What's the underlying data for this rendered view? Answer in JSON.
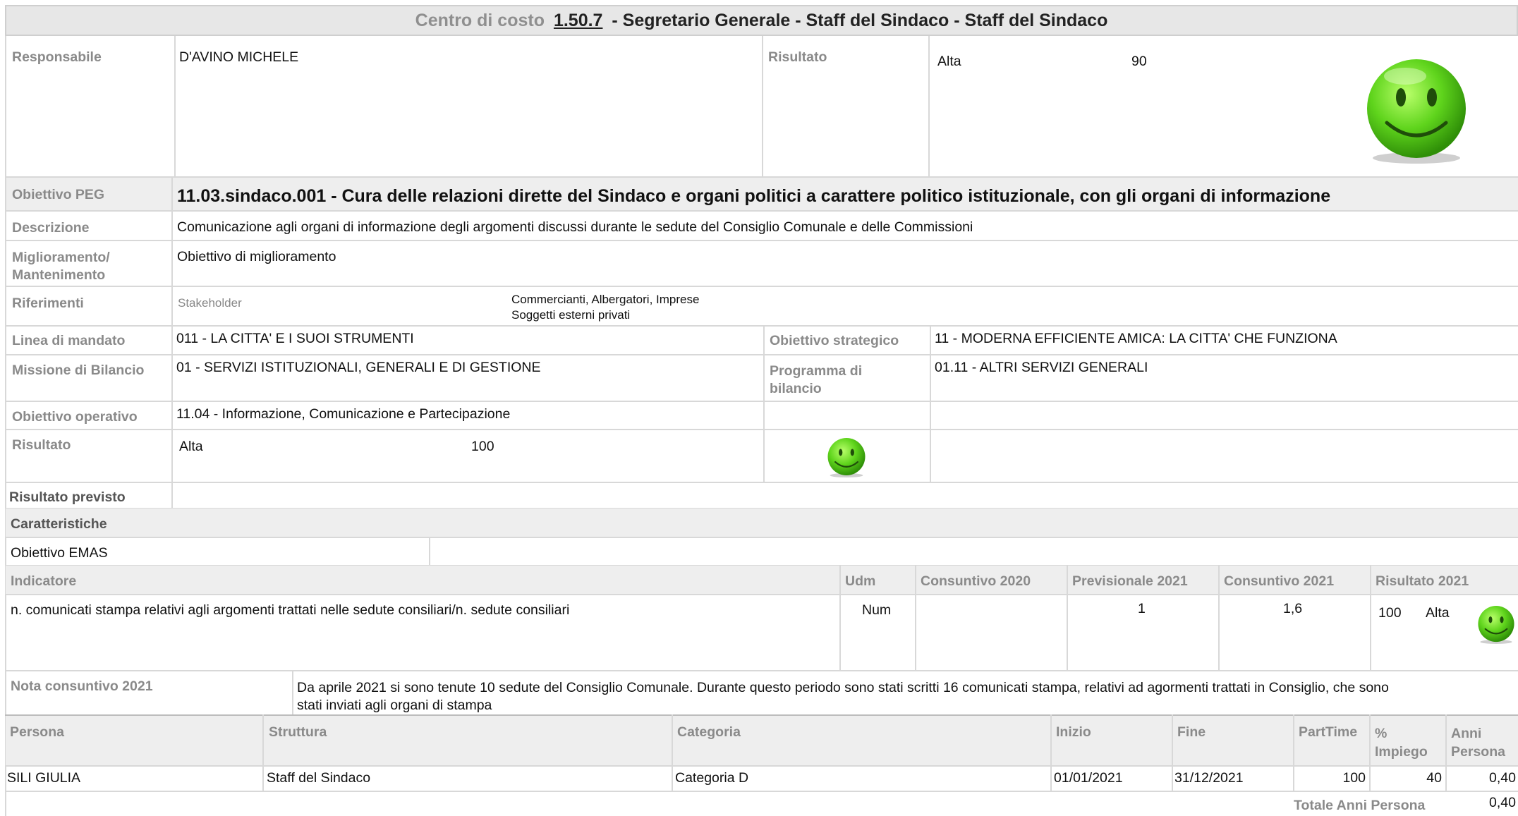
{
  "header": {
    "prefix": "Centro di costo",
    "code": "1.50.7",
    "title": "- Segretario Generale - Staff del Sindaco - Staff del Sindaco"
  },
  "responsabile": {
    "label": "Responsabile",
    "value": "D'AVINO MICHELE",
    "risultato_label": "Risultato",
    "risultato_level": "Alta",
    "risultato_score": "90",
    "icon": "smiley-green-icon"
  },
  "obiettivo_peg": {
    "label": "Obiettivo PEG",
    "value": "11.03.sindaco.001 - Cura delle relazioni dirette del Sindaco e organi politici a carattere politico istituzionale,  con gli organi di informazione"
  },
  "descrizione": {
    "label": "Descrizione",
    "value": "Comunicazione agli organi di informazione degli argomenti discussi durante le sedute del Consiglio Comunale e delle Commissioni"
  },
  "miglioramento": {
    "label_line1": "Miglioramento/",
    "label_line2": "Mantenimento",
    "value": "Obiettivo di miglioramento"
  },
  "riferimenti": {
    "label": "Riferimenti",
    "sub_label": "Stakeholder",
    "line1": "Commercianti, Albergatori, Imprese",
    "line2": "Soggetti esterni privati"
  },
  "linea_mandato": {
    "label": "Linea di mandato",
    "value": "011 - LA CITTA' E I SUOI STRUMENTI",
    "right_label": "Obiettivo strategico",
    "right_value": "11 - MODERNA EFFICIENTE AMICA: LA CITTA' CHE FUNZIONA"
  },
  "missione": {
    "label": "Missione di Bilancio",
    "value": "01 - SERVIZI ISTITUZIONALI, GENERALI E DI GESTIONE",
    "right_label_line1": "Programma di",
    "right_label_line2": "bilancio",
    "right_value": "01.11 - ALTRI SERVIZI GENERALI"
  },
  "obiettivo_operativo": {
    "label": "Obiettivo operativo",
    "value": "11.04 - Informazione, Comunicazione e Partecipazione"
  },
  "risultato": {
    "label": "Risultato",
    "level": "Alta",
    "score": "100"
  },
  "risultato_previsto": {
    "label": "Risultato previsto"
  },
  "caratteristiche": {
    "label": "Caratteristiche",
    "emas": "Obiettivo EMAS"
  },
  "indicatori": {
    "headers": [
      "Indicatore",
      "Udm",
      "Consuntivo 2020",
      "Previsionale 2021",
      "Consuntivo 2021",
      "Risultato 2021"
    ],
    "row": {
      "indicatore": "n. comunicati stampa relativi agli argomenti trattati nelle sedute consiliari/n. sedute consiliari",
      "udm": "Num",
      "consuntivo_2020": "",
      "previsionale_2021": "1",
      "consuntivo_2021": "1,6",
      "risultato_score": "100",
      "risultato_level": "Alta"
    }
  },
  "nota": {
    "label": "Nota consuntivo 2021",
    "line1": "Da aprile 2021 si sono tenute 10 sedute del Consiglio Comunale. Durante questo periodo sono stati scritti 16 comunicati stampa, relativi ad agormenti trattati in Consiglio, che sono",
    "line2": "stati inviati agli organi di stampa"
  },
  "persone": {
    "headers": {
      "persona": "Persona",
      "struttura": "Struttura",
      "categoria": "Categoria",
      "inizio": "Inizio",
      "fine": "Fine",
      "parttime": "PartTime",
      "impiego_line1": "%",
      "impiego_line2": "Impiego",
      "anni_line1": "Anni",
      "anni_line2": "Persona"
    },
    "rows": [
      {
        "persona": "SILI GIULIA",
        "struttura": "Staff del Sindaco",
        "categoria": "Categoria D",
        "inizio": "01/01/2021",
        "fine": "31/12/2021",
        "parttime": "100",
        "impiego": "40",
        "anni": "0,40"
      }
    ],
    "totale_label": "Totale Anni Persona",
    "totale_value": "0,40"
  }
}
